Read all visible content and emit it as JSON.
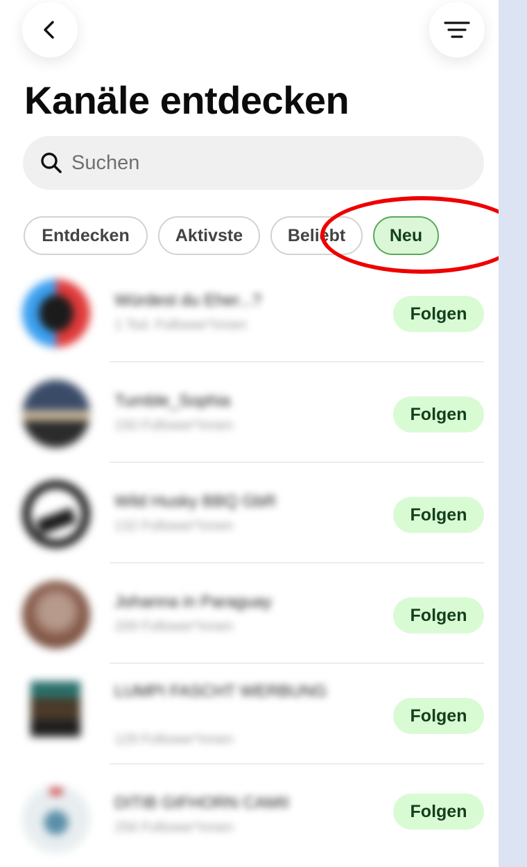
{
  "header": {
    "back_icon": "chevron-left-icon",
    "menu_icon": "filter-lines-icon",
    "title": "Kanäle entdecken"
  },
  "search": {
    "placeholder": "Suchen",
    "icon": "search-icon"
  },
  "filters": {
    "chips": [
      "Entdecken",
      "Aktivste",
      "Beliebt",
      "Neu"
    ],
    "selected": "Neu"
  },
  "channels": [
    {
      "name": "Würdest du Eher...?",
      "followers": "1 Tsd. Follower*innen",
      "follow_label": "Folgen"
    },
    {
      "name": "Tumble_Sophia",
      "followers": "150 Follower*innen",
      "follow_label": "Folgen"
    },
    {
      "name": "Wild Husky BBQ GbR",
      "followers": "132 Follower*innen",
      "follow_label": "Folgen"
    },
    {
      "name": "Johanna in Paraguay",
      "followers": "209 Follower*innen",
      "follow_label": "Folgen"
    },
    {
      "name": "LUMPI FASCHT WERBUNG",
      "followers": "129 Follower*innen",
      "follow_label": "Folgen"
    },
    {
      "name": "DITIB GIFHORN CAMII",
      "followers": "256 Follower*innen",
      "follow_label": "Folgen"
    }
  ],
  "colors": {
    "accent_chip_bg": "#dcf7d7",
    "accent_chip_border": "#57a85a",
    "follow_bg": "#d9fbd4",
    "follow_text": "#123f1c",
    "annotation_ring": "#ee0000",
    "frame_bg": "#dce4f4"
  }
}
